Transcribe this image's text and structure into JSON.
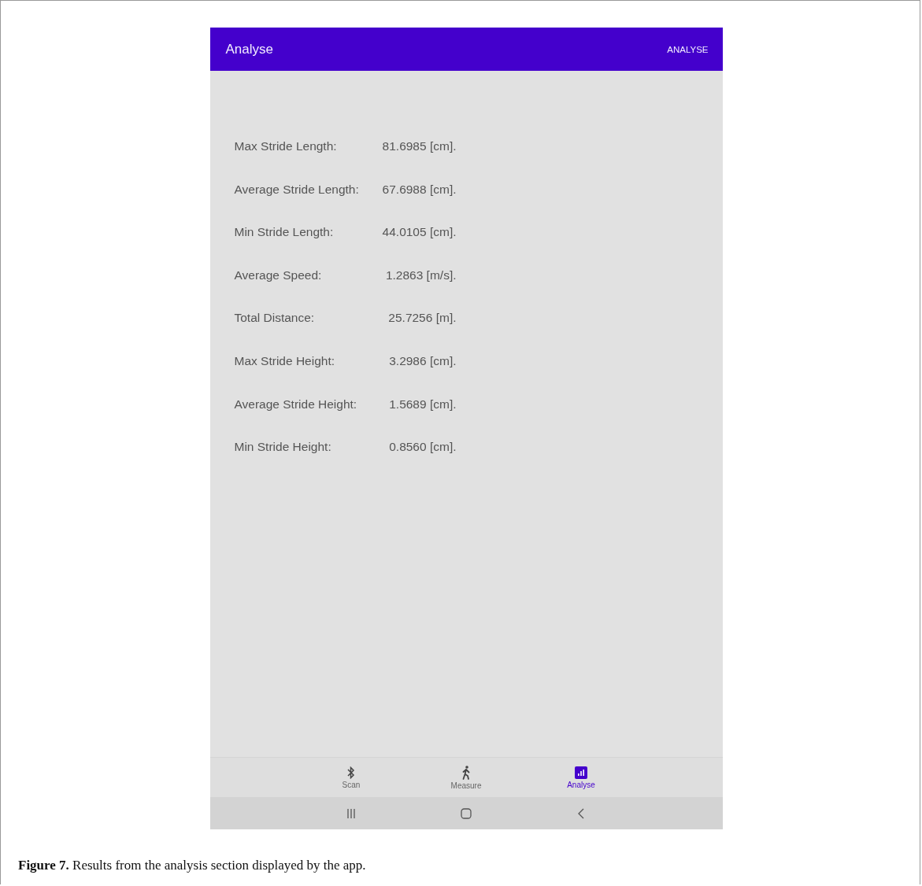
{
  "app_bar": {
    "title": "Analyse",
    "action": "ANALYSE"
  },
  "results": [
    {
      "label": "Max Stride Length:",
      "value": "81.6985 [cm]."
    },
    {
      "label": "Average Stride Length:",
      "value": "67.6988 [cm]."
    },
    {
      "label": "Min Stride Length:",
      "value": "44.0105 [cm]."
    },
    {
      "label": "Average Speed:",
      "value": "1.2863 [m/s]."
    },
    {
      "label": "Total Distance:",
      "value": "25.7256 [m]."
    },
    {
      "label": "Max Stride Height:",
      "value": "3.2986 [cm]."
    },
    {
      "label": "Average Stride Height:",
      "value": "1.5689 [cm]."
    },
    {
      "label": "Min Stride Height:",
      "value": "0.8560 [cm]."
    }
  ],
  "bottom_nav": [
    {
      "label": "Scan",
      "selected": false
    },
    {
      "label": "Measure",
      "selected": false
    },
    {
      "label": "Analyse",
      "selected": true
    }
  ],
  "caption": "**Figure 7.** Results from the analysis section displayed by the app."
}
